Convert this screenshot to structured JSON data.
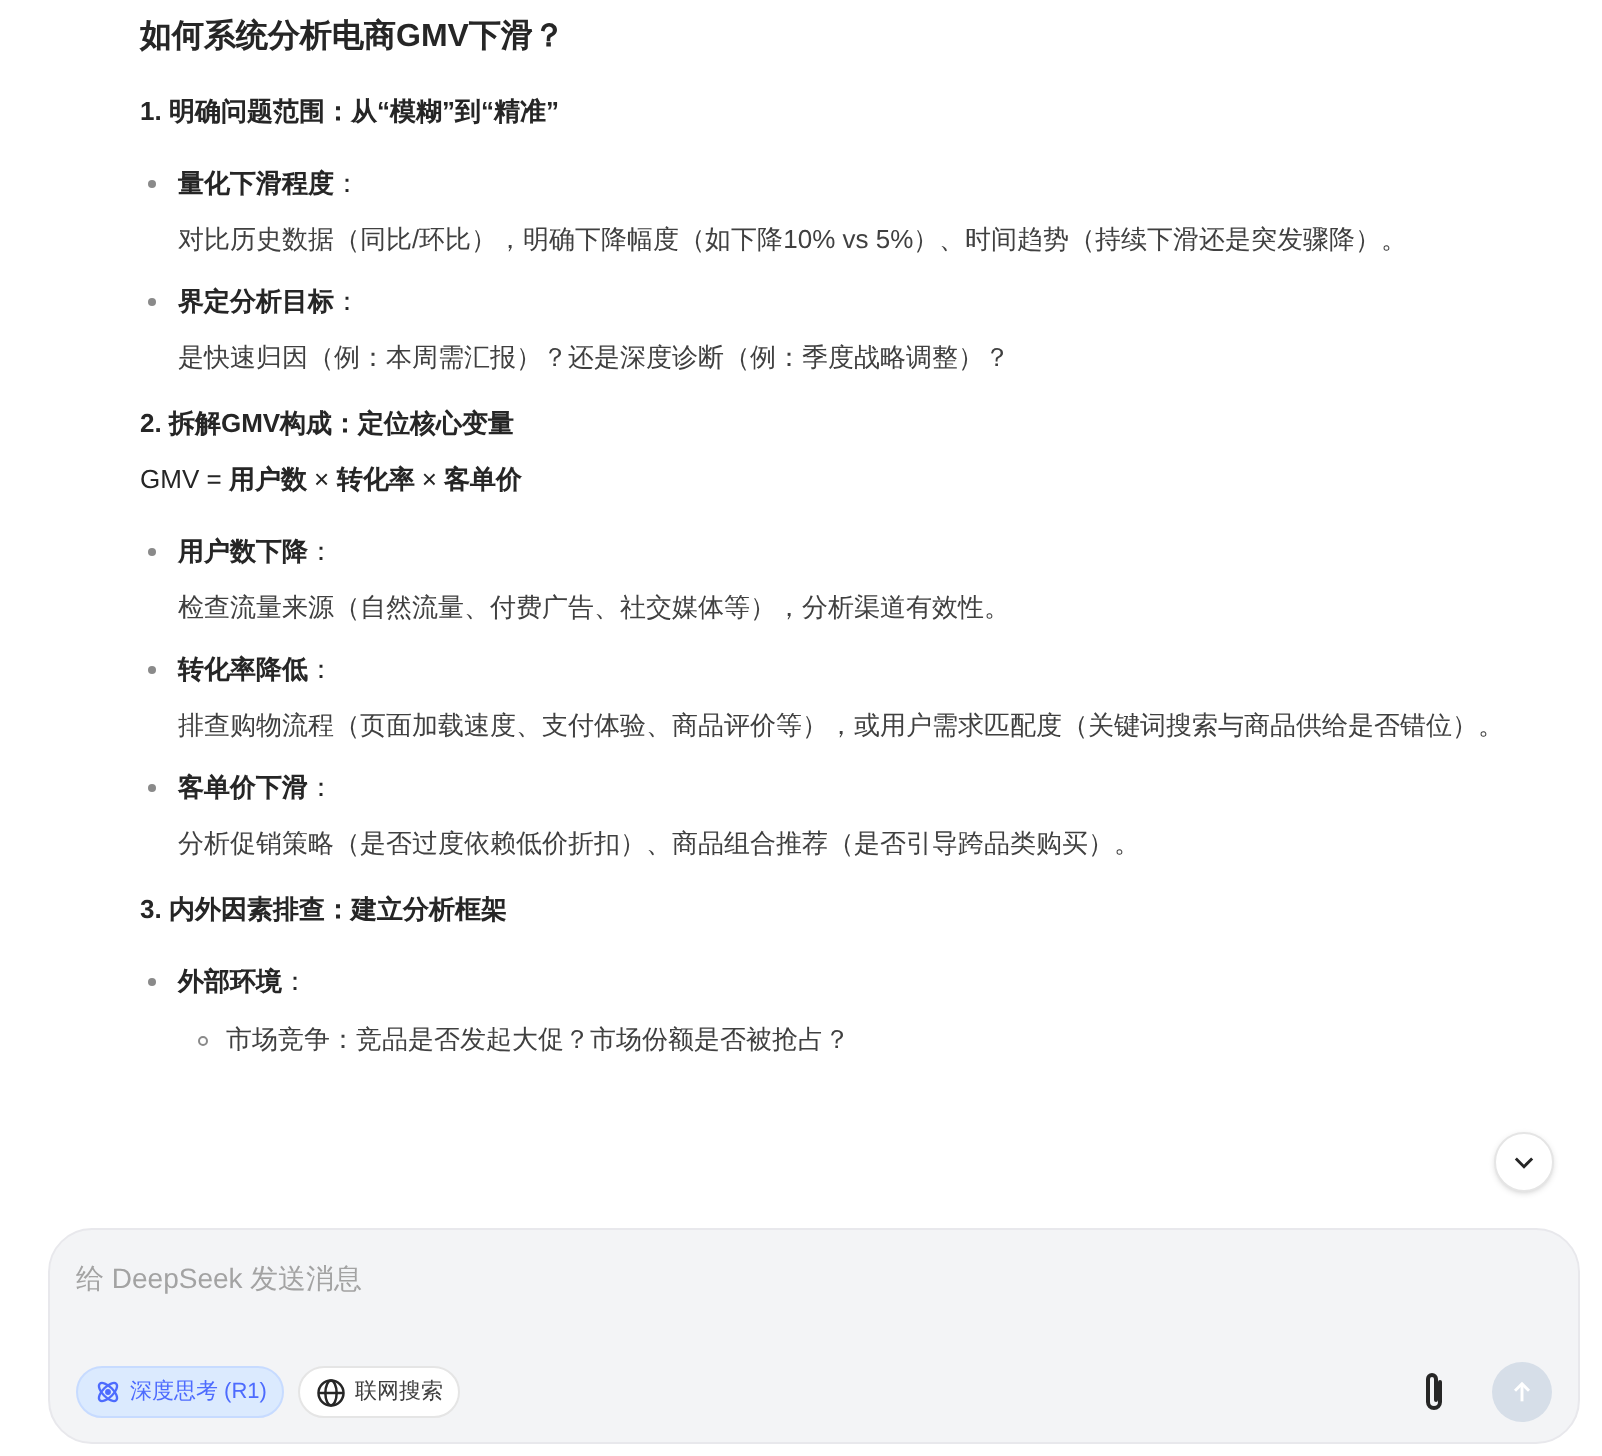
{
  "title": "如何系统分析电商GMV下滑？",
  "sections": [
    {
      "heading": "1. 明确问题范围：从“模糊”到“精准”",
      "items": [
        {
          "label": "**量化下滑程度**：",
          "text": "对比历史数据（同比/环比），明确下降幅度（如下降10% vs 5%）、时间趋势（持续下滑还是突发骤降）。"
        },
        {
          "label": "**界定分析目标**：",
          "text": "是快速归因（例：本周需汇报）？还是深度诊断（例：季度战略调整）？"
        }
      ]
    },
    {
      "heading": "2. 拆解GMV构成：定位核心变量",
      "formula": "GMV = **用户数** × **转化率** × **客单价**",
      "items": [
        {
          "label": "**用户数下降**：",
          "text": "检查流量来源（自然流量、付费广告、社交媒体等），分析渠道有效性。"
        },
        {
          "label": "**转化率降低**：",
          "text": "排查购物流程（页面加载速度、支付体验、商品评价等），或用户需求匹配度（关键词搜索与商品供给是否错位）。"
        },
        {
          "label": "**客单价下滑**：",
          "text": "分析促销策略（是否过度依赖低价折扣）、商品组合推荐（是否引导跨品类购买）。"
        }
      ]
    },
    {
      "heading": "3. 内外因素排查：建立分析框架",
      "items": [
        {
          "label": "**外部环境**：",
          "children": [
            {
              "text": "市场竞争：竞品是否发起大促？市场份额是否被抢占？"
            }
          ]
        }
      ]
    }
  ],
  "composer": {
    "placeholder": "给 DeepSeek 发送消息",
    "toggles": [
      {
        "kind": "deep-think",
        "label": "深度思考 (R1)",
        "selected": true
      },
      {
        "kind": "web-search",
        "label": "联网搜索",
        "selected": false
      }
    ],
    "send_disabled": true
  }
}
